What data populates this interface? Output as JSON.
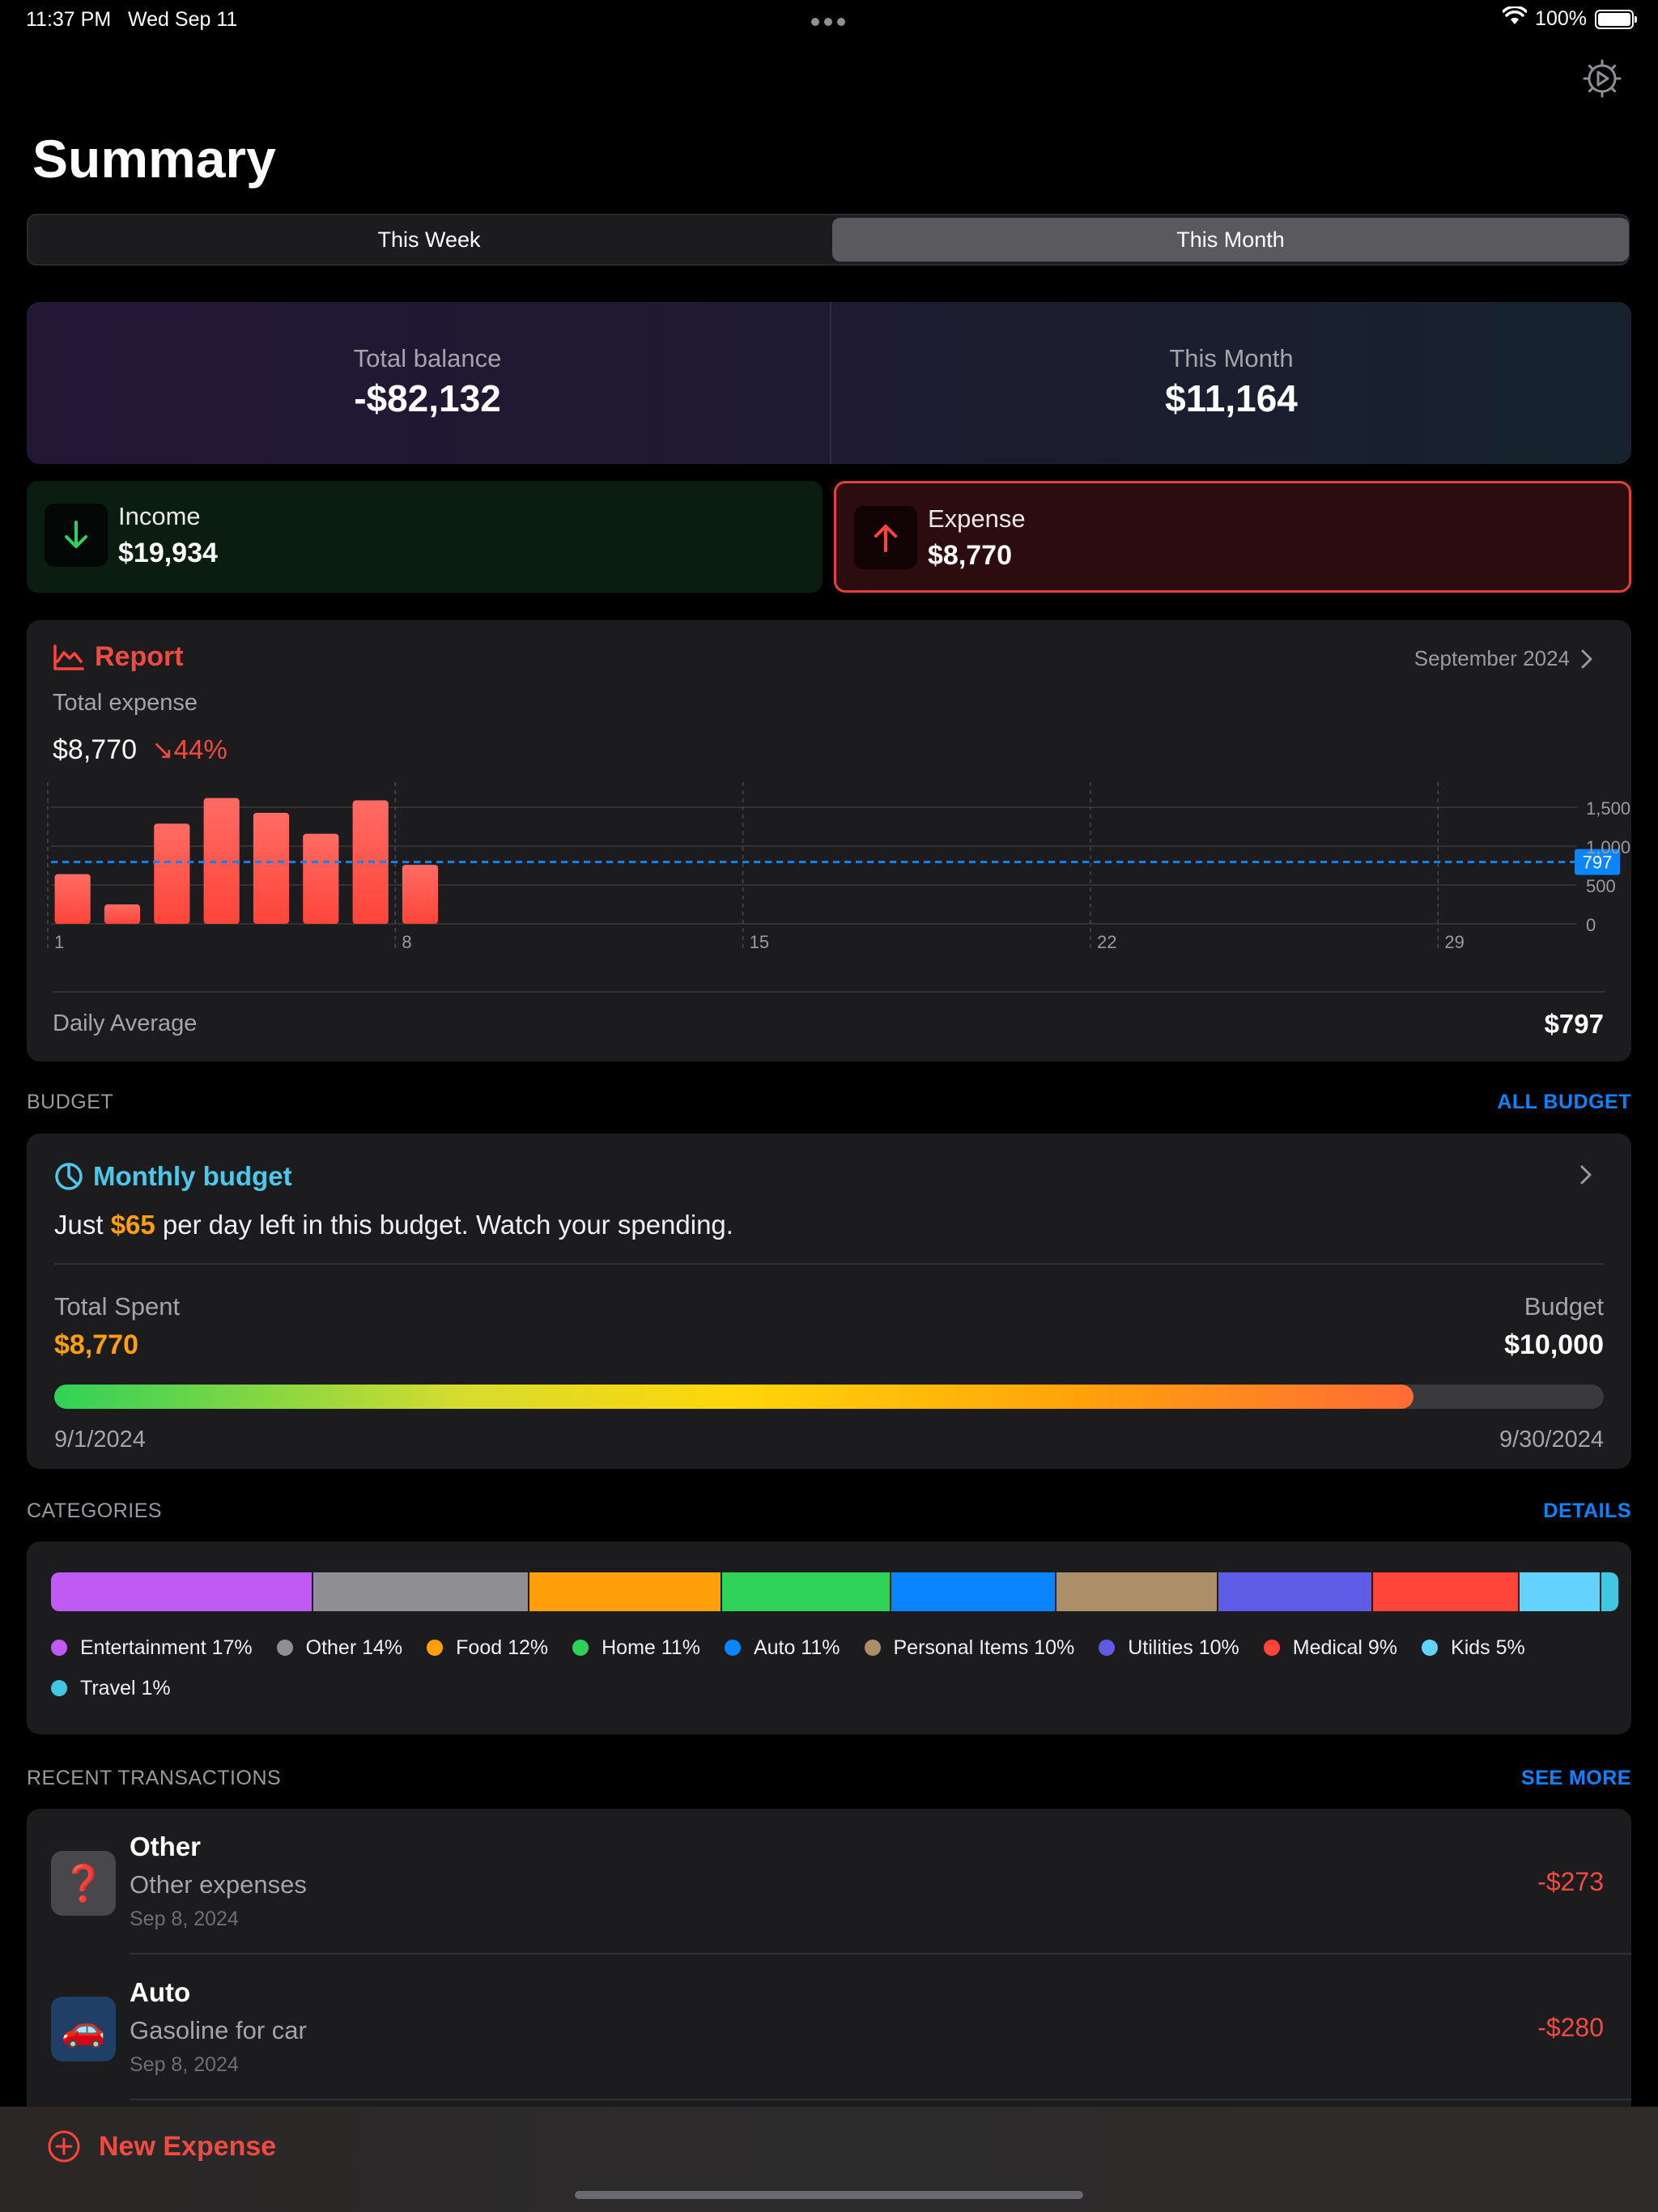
{
  "status": {
    "time": "11:37 PM",
    "date": "Wed Sep 11",
    "battery": "100%"
  },
  "header": {
    "title": "Summary"
  },
  "segments": [
    "This Week",
    "This Month"
  ],
  "balance": {
    "total_label": "Total balance",
    "total_value": "-$82,132",
    "month_label": "This Month",
    "month_value": "$11,164"
  },
  "income": {
    "label": "Income",
    "value": "$19,934"
  },
  "expense": {
    "label": "Expense",
    "value": "$8,770"
  },
  "report": {
    "title": "Report",
    "month": "September 2024",
    "subtitle": "Total expense",
    "total": "$8,770",
    "change": "44%",
    "avg_label": "Daily Average",
    "avg_value": "$797"
  },
  "chart_data": {
    "type": "bar",
    "categories": [
      "1",
      "2",
      "3",
      "4",
      "5",
      "6",
      "7",
      "8"
    ],
    "values": [
      640,
      250,
      1290,
      1620,
      1430,
      1160,
      1590,
      760
    ],
    "x_range": [
      1,
      30
    ],
    "x_ticks": [
      "1",
      "8",
      "15",
      "22",
      "29"
    ],
    "y_ticks": [
      "0",
      "500",
      "1,000",
      "1,500"
    ],
    "ylim": [
      0,
      1700
    ],
    "average": 797,
    "average_label": "797",
    "bar_color": "#ff453a",
    "avg_color": "#0a84ff"
  },
  "budget": {
    "section_title": "BUDGET",
    "section_link": "ALL BUDGET",
    "title": "Monthly budget",
    "msg_pre": "Just ",
    "msg_amount": "$65",
    "msg_post": " per day left in this budget. Watch your spending.",
    "spent_label": "Total Spent",
    "spent_value": "$8,770",
    "budget_label": "Budget",
    "budget_value": "$10,000",
    "progress": 0.877,
    "start_date": "9/1/2024",
    "end_date": "9/30/2024"
  },
  "categories": {
    "section_title": "CATEGORIES",
    "section_link": "DETAILS",
    "items": [
      {
        "name": "Entertainment",
        "pct": "17%",
        "share": 17,
        "color": "#bf5af2"
      },
      {
        "name": "Other",
        "pct": "14%",
        "share": 14,
        "color": "#8e8e93"
      },
      {
        "name": "Food",
        "pct": "12%",
        "share": 12.5,
        "color": "#ff9f0a"
      },
      {
        "name": "Home",
        "pct": "11%",
        "share": 11,
        "color": "#30d158"
      },
      {
        "name": "Auto",
        "pct": "11%",
        "share": 10.7,
        "color": "#0a84ff"
      },
      {
        "name": "Personal Items",
        "pct": "10%",
        "share": 10.5,
        "color": "#ac8e68"
      },
      {
        "name": "Utilities",
        "pct": "10%",
        "share": 10,
        "color": "#5e5ce6"
      },
      {
        "name": "Medical",
        "pct": "9%",
        "share": 9.5,
        "color": "#ff453a"
      },
      {
        "name": "Kids",
        "pct": "5%",
        "share": 5.3,
        "color": "#64d2ff"
      },
      {
        "name": "Travel",
        "pct": "1%",
        "share": 1.1,
        "color": "#40c8e0"
      }
    ]
  },
  "transactions": {
    "section_title": "RECENT TRANSACTIONS",
    "section_link": "SEE MORE",
    "items": [
      {
        "title": "Other",
        "desc": "Other expenses",
        "date": "Sep 8, 2024",
        "amount": "-$273",
        "icon": "question-mark-icon",
        "icon_glyph": "❓",
        "icon_bg": "#48484c"
      },
      {
        "title": "Auto",
        "desc": "Gasoline for car",
        "date": "Sep 8, 2024",
        "amount": "-$280",
        "icon": "car-icon",
        "icon_glyph": "🚗",
        "icon_bg": "#1f3f66"
      }
    ]
  },
  "bottom": {
    "new_expense": "New Expense"
  }
}
